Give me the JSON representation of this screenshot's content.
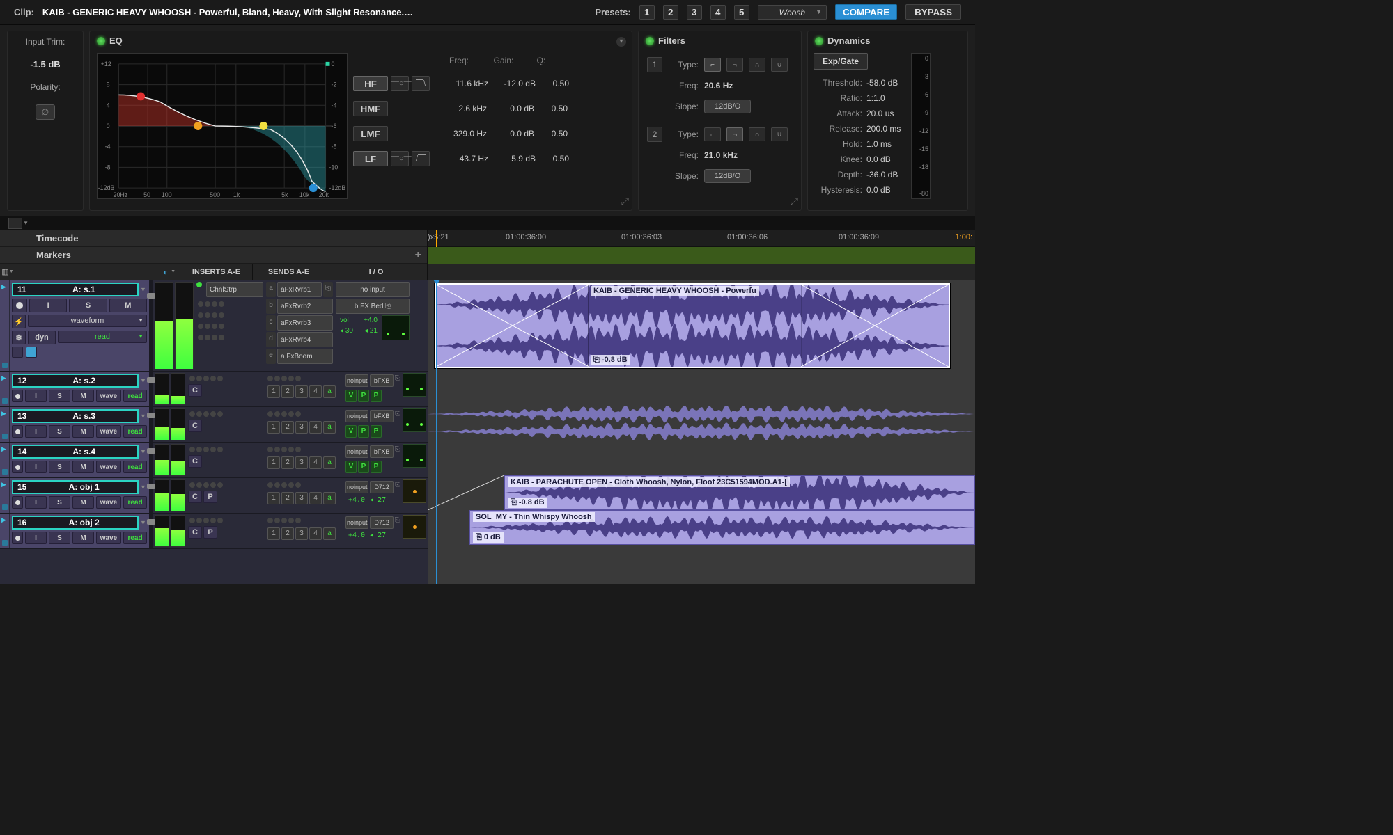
{
  "topbar": {
    "clip_label": "Clip:",
    "clip_name": "KAIB - GENERIC HEAVY WHOOSH - Powerful,  Bland, Heavy, With Slight Resonance.wav_...",
    "presets_label": "Presets:",
    "preset_nums": [
      "1",
      "2",
      "3",
      "4",
      "5"
    ],
    "preset_name": "Woosh",
    "compare": "COMPARE",
    "bypass": "BYPASS"
  },
  "trim": {
    "label": "Input Trim:",
    "value": "-1.5 dB",
    "polarity_label": "Polarity:",
    "polarity_glyph": "∅"
  },
  "eq": {
    "title": "EQ",
    "hdr_freq": "Freq:",
    "hdr_gain": "Gain:",
    "hdr_q": "Q:",
    "ylabels": [
      "+12",
      "8",
      "4",
      "0",
      "-4",
      "-8",
      "-12dB"
    ],
    "rlabels": [
      "0",
      "-2",
      "-4",
      "-6",
      "-8",
      "-10",
      "-12dB"
    ],
    "xlabels": [
      "20Hz",
      "50",
      "100",
      "500",
      "1k",
      "5k",
      "10k",
      "20k"
    ],
    "bands": [
      {
        "name": "HF",
        "freq": "11.6 kHz",
        "gain": "-12.0 dB",
        "q": "0.50",
        "active": true
      },
      {
        "name": "HMF",
        "freq": "2.6 kHz",
        "gain": "0.0 dB",
        "q": "0.50",
        "active": false
      },
      {
        "name": "LMF",
        "freq": "329.0 Hz",
        "gain": "0.0 dB",
        "q": "0.50",
        "active": false
      },
      {
        "name": "LF",
        "freq": "43.7 Hz",
        "gain": "5.9 dB",
        "q": "0.50",
        "active": true
      }
    ]
  },
  "filters": {
    "title": "Filters",
    "rows": [
      {
        "num": "1",
        "type_label": "Type:",
        "freq_label": "Freq:",
        "freq": "20.6 Hz",
        "slope_label": "Slope:",
        "slope": "12dB/O"
      },
      {
        "num": "2",
        "type_label": "Type:",
        "freq_label": "Freq:",
        "freq": "21.0 kHz",
        "slope_label": "Slope:",
        "slope": "12dB/O"
      }
    ]
  },
  "dynamics": {
    "title": "Dynamics",
    "tab": "Exp/Gate",
    "meter_ticks": [
      "0",
      "-3",
      "-6",
      "-9",
      "-12",
      "-15",
      "-18",
      "-80"
    ],
    "params": [
      {
        "l": "Threshold:",
        "v": "-58.0 dB"
      },
      {
        "l": "Ratio:",
        "v": "1:1.0"
      },
      {
        "l": "Attack:",
        "v": "20.0 us"
      },
      {
        "l": "Release:",
        "v": "200.0 ms"
      },
      {
        "l": "Hold:",
        "v": "1.0 ms"
      },
      {
        "l": "Knee:",
        "v": "0.0 dB"
      },
      {
        "l": "Depth:",
        "v": "-36.0 dB"
      },
      {
        "l": "Hysteresis:",
        "v": "0.0 dB"
      }
    ]
  },
  "timeline": {
    "timecode_label": "Timecode",
    "markers_label": "Markers",
    "playhead_tc": "5:21",
    "end_tc": "1:00:",
    "ticks": [
      "01:00:36:00",
      "01:00:36:03",
      "01:00:36:06",
      "01:00:36:09"
    ]
  },
  "columns": {
    "inserts": "INSERTS A-E",
    "sends": "SENDS A-E",
    "io": "I / O"
  },
  "track1": {
    "num": "11",
    "name": "A: s.1",
    "i": "I",
    "s": "S",
    "m": "M",
    "view": "waveform",
    "dyn": "dyn",
    "read": "read",
    "inserts": [
      {
        "ltr": "",
        "name": "ChnlStrp",
        "on": true
      }
    ],
    "insert_dots": [
      "",
      "",
      "",
      ""
    ],
    "sends": [
      {
        "ltr": "a",
        "name": "aFxRvrb1",
        "link": true
      },
      {
        "ltr": "b",
        "name": "aFxRvrb2"
      },
      {
        "ltr": "c",
        "name": "aFxRvrb3"
      },
      {
        "ltr": "d",
        "name": "aFxRvrb4"
      },
      {
        "ltr": "e",
        "name": "a FxBoom"
      }
    ],
    "io_in": "no input",
    "io_out": "b FX Bed",
    "vol_label": "vol",
    "vol": "+4.0",
    "pan_l": "30",
    "pan_r": "21"
  },
  "tracks_short": [
    {
      "num": "12",
      "name": "A: s.2",
      "io1": "noinput",
      "io2": "bFXB",
      "vol": "",
      "d": "",
      "grid": true
    },
    {
      "num": "13",
      "name": "A: s.3",
      "io1": "noinput",
      "io2": "bFXB",
      "vol": "",
      "d": "",
      "grid": true,
      "wave": true
    },
    {
      "num": "14",
      "name": "A: s.4",
      "io1": "noinput",
      "io2": "bFXB",
      "vol": "",
      "d": "",
      "grid": true
    },
    {
      "num": "15",
      "name": "A: obj 1",
      "io1": "noinput",
      "io2": "D712",
      "vol": "+4.0",
      "d": "27",
      "grid": false
    },
    {
      "num": "16",
      "name": "A: obj 2",
      "io1": "noinput",
      "io2": "D712",
      "vol": "+4.0",
      "d": "27",
      "grid": false
    }
  ],
  "short_common": {
    "i": "I",
    "s": "S",
    "m": "M",
    "wave": "wave",
    "read": "read",
    "c": "C",
    "p": "P",
    "send_nums": [
      "1",
      "2",
      "3",
      "4"
    ],
    "send_a": "a",
    "v": "V",
    "pp": "P"
  },
  "clips": {
    "main": {
      "name": "KAIB - GENERIC HEAVY WHOOSH - Powerfu",
      "gain": "-0.8 dB"
    },
    "obj1": {
      "name": "KAIB - PARACHUTE OPEN - Cloth Whoosh, Nylon, Floof 23C51594MOD.A1-[",
      "gain": "-0.8 dB"
    },
    "obj2": {
      "name": "SOL_MY - Thin Whispy Whoosh",
      "gain": "0 dB"
    }
  }
}
